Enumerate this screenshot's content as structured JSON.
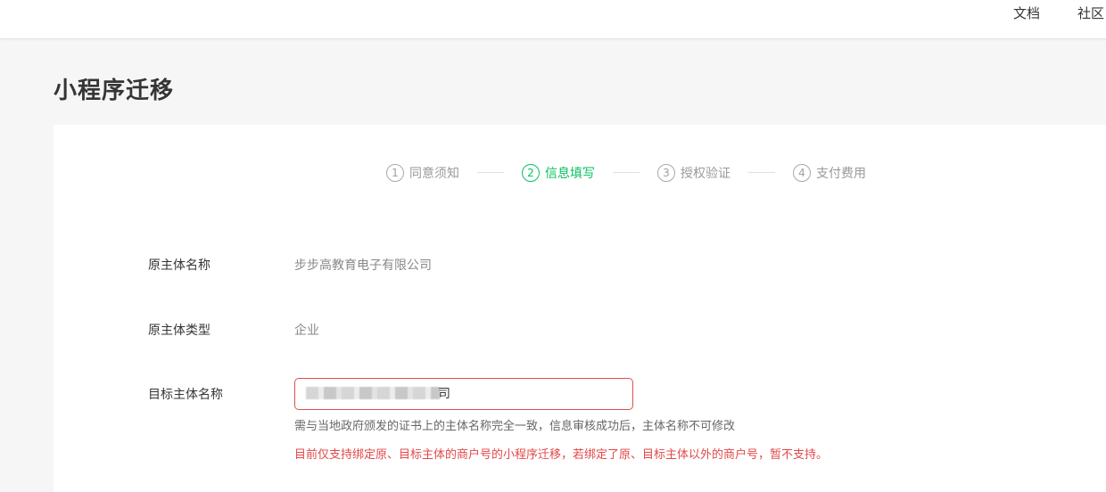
{
  "topnav": {
    "docs": "文档",
    "community": "社区"
  },
  "page": {
    "title": "小程序迁移"
  },
  "steps": [
    {
      "num": "1",
      "label": "同意须知",
      "active": false
    },
    {
      "num": "2",
      "label": "信息填写",
      "active": true
    },
    {
      "num": "3",
      "label": "授权验证",
      "active": false
    },
    {
      "num": "4",
      "label": "支付费用",
      "active": false
    }
  ],
  "form": {
    "original_name": {
      "label": "原主体名称",
      "value": "步步高教育电子有限公司"
    },
    "original_type": {
      "label": "原主体类型",
      "value": "企业"
    },
    "target_name": {
      "label": "目标主体名称",
      "visible_value_tail": "司",
      "hint": "需与当地政府颁发的证书上的主体名称完全一致，信息审核成功后，主体名称不可修改",
      "warning": "目前仅支持绑定原、目标主体的商户号的小程序迁移，若绑定了原、目标主体以外的商户号，暂不支持。"
    }
  },
  "colors": {
    "accent": "#07c160",
    "error": "#e34848"
  }
}
